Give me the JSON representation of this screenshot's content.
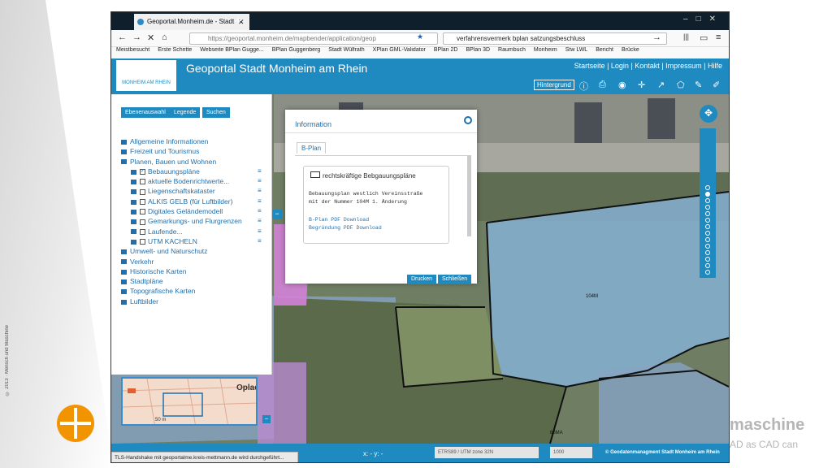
{
  "slide": {
    "copyright": "© 2013 · Mensch und Maschine",
    "brand_name": "maschine",
    "brand_tag": "AD as CAD can"
  },
  "browser": {
    "tab_title": "Geoportal.Monheim.de - Stadt",
    "url": "https://geoportal.monheim.de/mapbender/application/geop",
    "search_value": "verfahrensvermerk bplan satzungsbeschluss",
    "bookmarks": [
      "Meistbesucht",
      "Erste Schritte",
      "Webseite BPlan Gugge...",
      "BPlan Guggenberg",
      "Stadt Wülfrath",
      "XPlan GML-Validator",
      "BPlan 2D",
      "BPlan 3D",
      "Raumbuch",
      "Monheim",
      "Stw LWL",
      "Bericht",
      "Brücke"
    ]
  },
  "app": {
    "logo_text": "MONHEIM AM RHEIN",
    "title": "Geoportal Stadt Monheim am Rhein",
    "topnav": "Startseite | Login | Kontakt | Impressum | Hilfe",
    "hintergrund": "Hintergrund"
  },
  "panel": {
    "buttons": [
      "Ebenenauswahl",
      "Legende",
      "Suchen"
    ],
    "tree": [
      {
        "label": "Allgemeine Informationen",
        "level": 1
      },
      {
        "label": "Freizeit und Tourismus",
        "level": 1
      },
      {
        "label": "Planen, Bauen und Wohnen",
        "level": 1
      },
      {
        "label": "Bebauungspläne",
        "level": 2,
        "checked": true
      },
      {
        "label": "aktuelle Bodenrichtwerte...",
        "level": 2
      },
      {
        "label": "Liegenschaftskataster",
        "level": 2
      },
      {
        "label": "ALKIS GELB (für Luftbilder)",
        "level": 2
      },
      {
        "label": "Digitales Geländemodell",
        "level": 2
      },
      {
        "label": "Gemarkungs- und Flurgrenzen",
        "level": 2
      },
      {
        "label": "Laufende...",
        "level": 2
      },
      {
        "label": "UTM KACHELN",
        "level": 2
      },
      {
        "label": "Umwelt- und Naturschutz",
        "level": 1
      },
      {
        "label": "Verkehr",
        "level": 1
      },
      {
        "label": "Historische Karten",
        "level": 1
      },
      {
        "label": "Stadtpläne",
        "level": 1
      },
      {
        "label": "Topografische Karten",
        "level": 1
      },
      {
        "label": "Luftbilder",
        "level": 1
      }
    ]
  },
  "dialog": {
    "title": "Information",
    "tab": "B-Plan",
    "heading": "rechtskräftige Bebgauungspläne",
    "line1": "Bebauungsplan westlich Vereinsstraße",
    "line2": "mit der Nummer 104M 1. Änderung",
    "link1": "B-Plan PDF Download",
    "link2": "Begründung PDF Download",
    "print": "Drucken",
    "close": "Schließen"
  },
  "map": {
    "label1": "104M",
    "label2": "66MA",
    "overview_label": "Oplad",
    "overview_scale": "50 m"
  },
  "status": {
    "coords": "x: - y: -",
    "srs": "ETRS89 / UTM zone 32N",
    "scale": "1000",
    "credit": "© Geodatenmanagment Stadt Monheim am Rhein",
    "tls": "TLS-Handshake mit geoportalme.kreis-mettmann.de wird durchgeführt..."
  }
}
